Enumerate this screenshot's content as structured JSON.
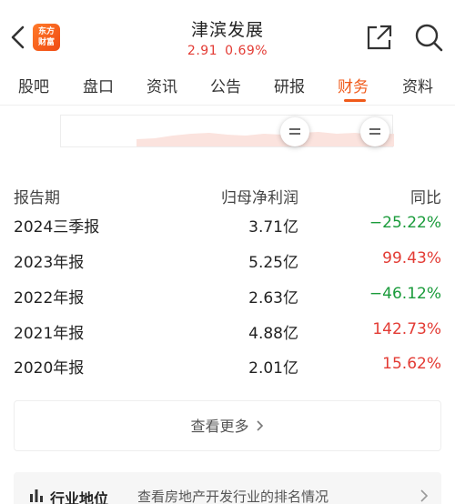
{
  "header": {
    "stock_name": "津滨发展",
    "price": "2.91",
    "change_pct": "0.69%",
    "logo_line1": "东方",
    "logo_line2": "财富"
  },
  "tabs": [
    "股吧",
    "盘口",
    "资讯",
    "公告",
    "研报",
    "财务",
    "资料"
  ],
  "active_tab": "财务",
  "table": {
    "headers": [
      "报告期",
      "归母净利润",
      "同比"
    ],
    "rows": [
      {
        "period": "2024三季报",
        "profit": "3.71亿",
        "yoy": "−25.22%",
        "trend": "down"
      },
      {
        "period": "2023年报",
        "profit": "5.25亿",
        "yoy": "99.43%",
        "trend": "up"
      },
      {
        "period": "2022年报",
        "profit": "2.63亿",
        "yoy": "−46.12%",
        "trend": "down"
      },
      {
        "period": "2021年报",
        "profit": "4.88亿",
        "yoy": "142.73%",
        "trend": "up"
      },
      {
        "period": "2020年报",
        "profit": "2.01亿",
        "yoy": "15.62%",
        "trend": "up"
      }
    ]
  },
  "more_button": "查看更多",
  "industry": {
    "label": "行业地位",
    "description": "查看房地产开发行业的排名情况"
  },
  "colors": {
    "accent": "#f05a1a",
    "up": "#e33b34",
    "down": "#1a9b3b"
  }
}
